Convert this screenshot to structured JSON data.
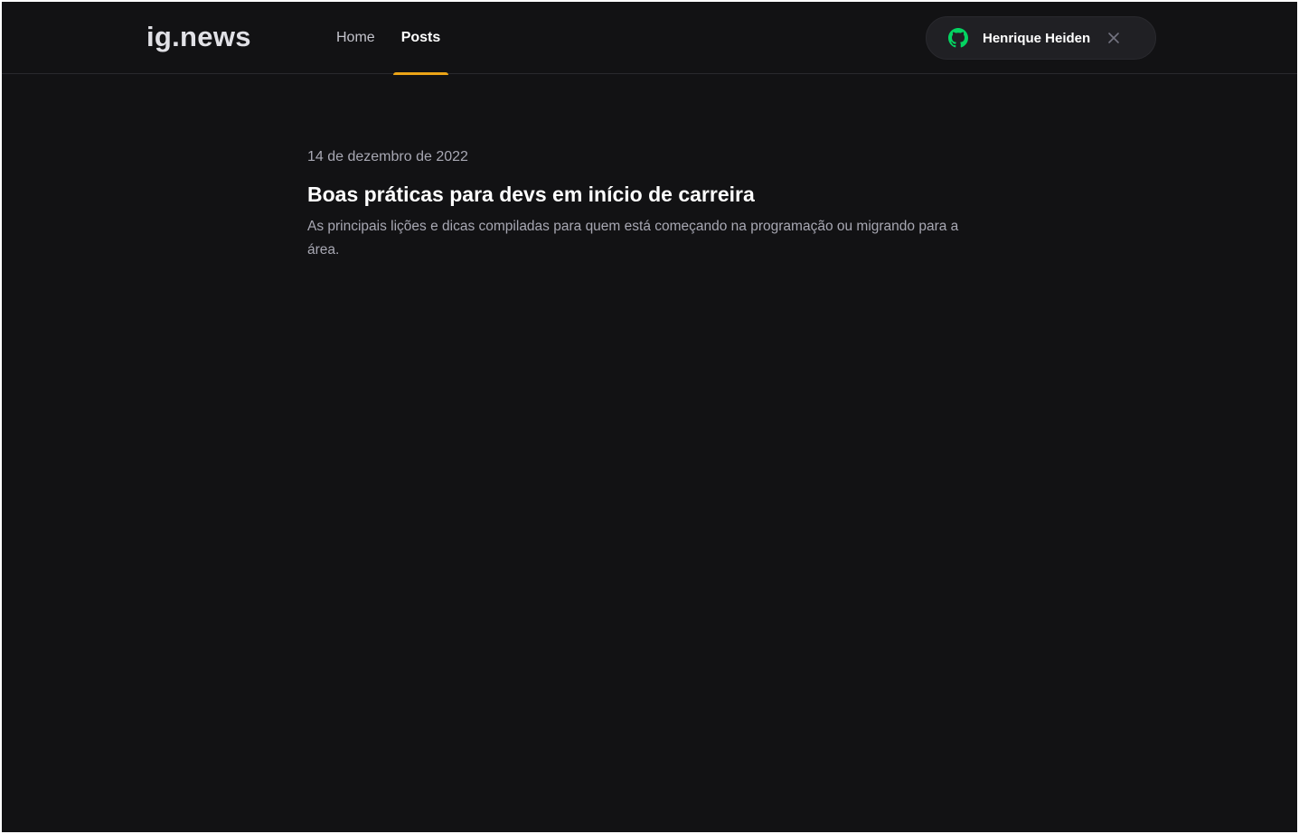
{
  "header": {
    "logo": "ig.news",
    "nav": [
      {
        "label": "Home",
        "active": false
      },
      {
        "label": "Posts",
        "active": true
      }
    ],
    "user_button": {
      "name": "Henrique Heiden",
      "icon": "github-icon",
      "icon_color": "#04d361",
      "close_icon": "close-icon"
    }
  },
  "main": {
    "posts": [
      {
        "date": "14 de dezembro de 2022",
        "title": "Boas práticas para devs em início de carreira",
        "excerpt": "As principais lições e dicas compiladas para quem está começando na programação ou migrando para a área."
      }
    ]
  },
  "colors": {
    "background": "#121214",
    "accent": "#eba417",
    "github_green": "#04d361"
  }
}
